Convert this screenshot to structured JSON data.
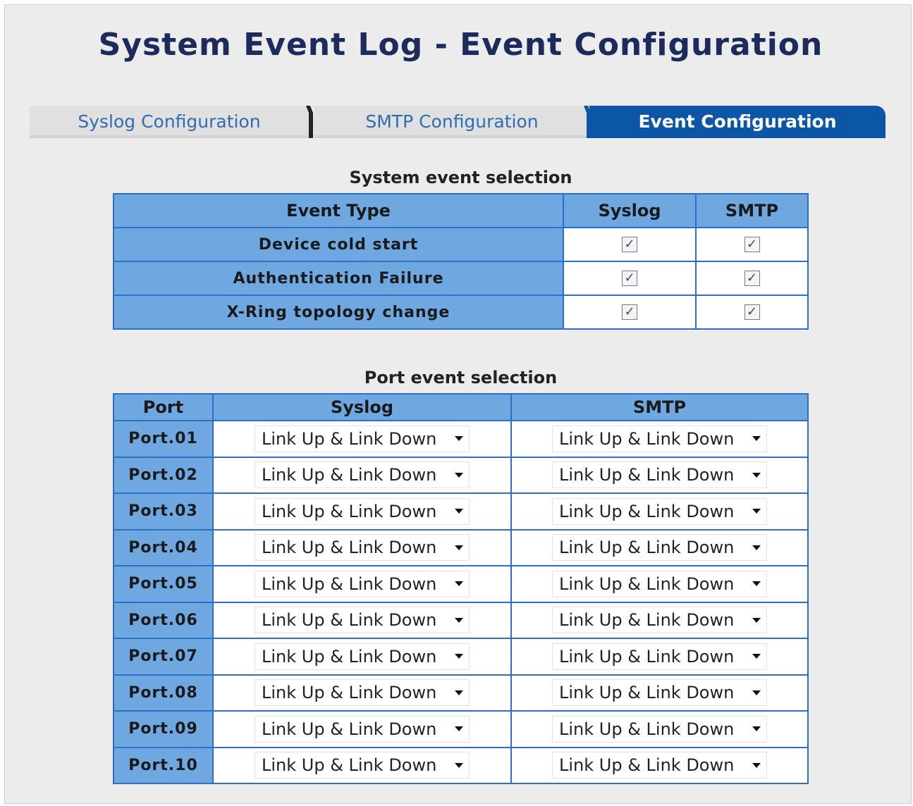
{
  "page": {
    "title": "System Event Log - Event Configuration"
  },
  "tabs": [
    {
      "label": "Syslog Configuration",
      "active": false
    },
    {
      "label": "SMTP Configuration",
      "active": false
    },
    {
      "label": "Event Configuration",
      "active": true
    }
  ],
  "system_events": {
    "title": "System event selection",
    "headers": {
      "event_type": "Event Type",
      "syslog": "Syslog",
      "smtp": "SMTP"
    },
    "rows": [
      {
        "event": "Device cold start",
        "syslog": true,
        "smtp": true
      },
      {
        "event": "Authentication Failure",
        "syslog": true,
        "smtp": true
      },
      {
        "event": "X-Ring topology change",
        "syslog": true,
        "smtp": true
      }
    ]
  },
  "port_events": {
    "title": "Port event selection",
    "headers": {
      "port": "Port",
      "syslog": "Syslog",
      "smtp": "SMTP"
    },
    "rows": [
      {
        "port": "Port.01",
        "syslog": "Link Up & Link Down",
        "smtp": "Link Up & Link Down"
      },
      {
        "port": "Port.02",
        "syslog": "Link Up & Link Down",
        "smtp": "Link Up & Link Down"
      },
      {
        "port": "Port.03",
        "syslog": "Link Up & Link Down",
        "smtp": "Link Up & Link Down"
      },
      {
        "port": "Port.04",
        "syslog": "Link Up & Link Down",
        "smtp": "Link Up & Link Down"
      },
      {
        "port": "Port.05",
        "syslog": "Link Up & Link Down",
        "smtp": "Link Up & Link Down"
      },
      {
        "port": "Port.06",
        "syslog": "Link Up & Link Down",
        "smtp": "Link Up & Link Down"
      },
      {
        "port": "Port.07",
        "syslog": "Link Up & Link Down",
        "smtp": "Link Up & Link Down"
      },
      {
        "port": "Port.08",
        "syslog": "Link Up & Link Down",
        "smtp": "Link Up & Link Down"
      },
      {
        "port": "Port.09",
        "syslog": "Link Up & Link Down",
        "smtp": "Link Up & Link Down"
      },
      {
        "port": "Port.10",
        "syslog": "Link Up & Link Down",
        "smtp": "Link Up & Link Down"
      }
    ]
  },
  "colors": {
    "title": "#1c2b5c",
    "active_tab": "#0c56a6",
    "header_cell": "#6fa8e0",
    "grid_border": "#2d6fc6",
    "inactive_tab_text": "#2f6db3"
  },
  "icons": {
    "checkbox_checked": "check-icon",
    "select_caret": "chevron-down-icon"
  }
}
